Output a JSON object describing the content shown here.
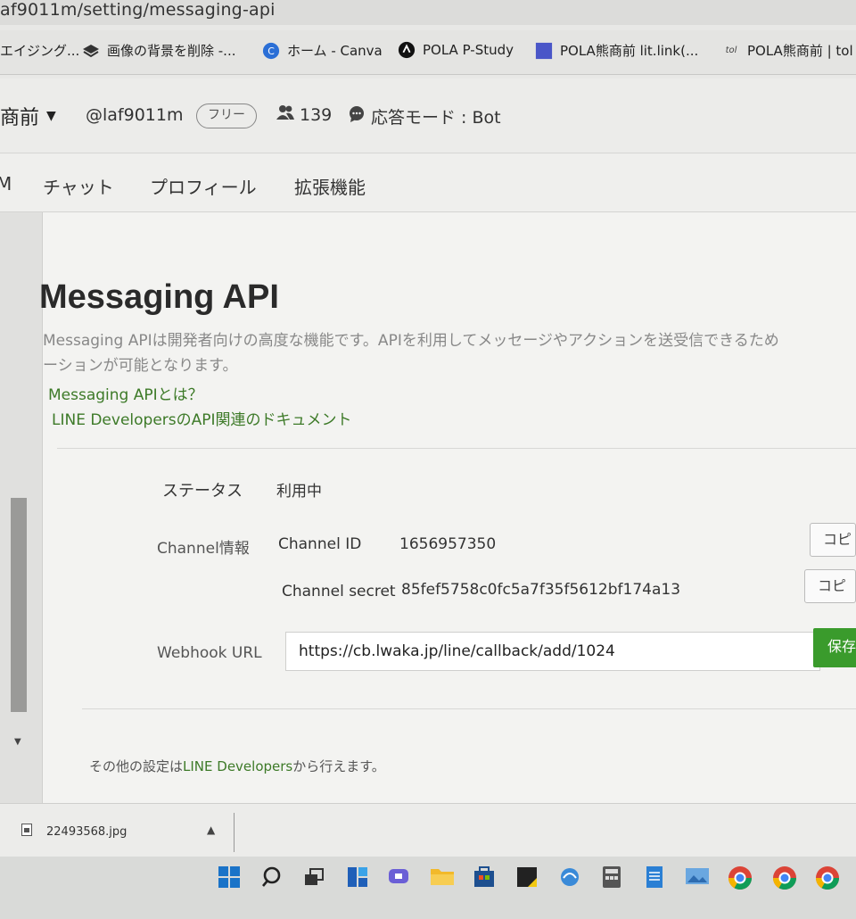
{
  "browser": {
    "url": "af9011m/setting/messaging-api",
    "bookmarks": [
      {
        "label": "エイジング...",
        "icon": "folder-icon"
      },
      {
        "label": "画像の背景を削除 -...",
        "icon": "layers-icon"
      },
      {
        "label": "ホーム - Canva",
        "icon": "canva-icon"
      },
      {
        "label": "POLA P-Study",
        "icon": "study-icon"
      },
      {
        "label": "POLA熊商前 lit.link(...",
        "icon": "litlink-icon"
      },
      {
        "label": "POLA熊商前 | tol",
        "icon": "tol-icon"
      }
    ]
  },
  "account": {
    "name": "熊商前",
    "id": "@laf9011m",
    "plan": "フリー",
    "friends": "139",
    "mode": "応答モード : Bot"
  },
  "nav": {
    "partial": "M",
    "items": [
      "チャット",
      "プロフィール",
      "拡張機能"
    ]
  },
  "page": {
    "title": "Messaging API",
    "description_line1": "Messaging APIは開発者向けの高度な機能です。APIを利用してメッセージやアクションを送受信できるため",
    "description_line2": "ーションが可能となります。",
    "link_what": "Messaging APIとは？",
    "link_docs": "LINE DevelopersのAPI関連のドキュメント",
    "status_label": "ステータス",
    "status_value": "利用中",
    "channel_label": "Channel情報",
    "channel_id_label": "Channel ID",
    "channel_id_value": "1656957350",
    "channel_secret_label": "Channel secret",
    "channel_secret_value": "85fef5758c0fc5a7f35f5612bf174a13",
    "copy_label": "コピー",
    "webhook_label": "Webhook URL",
    "webhook_value": "https://cb.lwaka.jp/line/callback/add/1024",
    "save_label": "保存",
    "footer_pre": "その他の設定は",
    "footer_link": "LINE Developers",
    "footer_post": "から行えます。"
  },
  "downloads": {
    "file": "22493568.jpg"
  },
  "colors": {
    "link": "#3d7a28",
    "save_button": "#3a9b2c"
  }
}
